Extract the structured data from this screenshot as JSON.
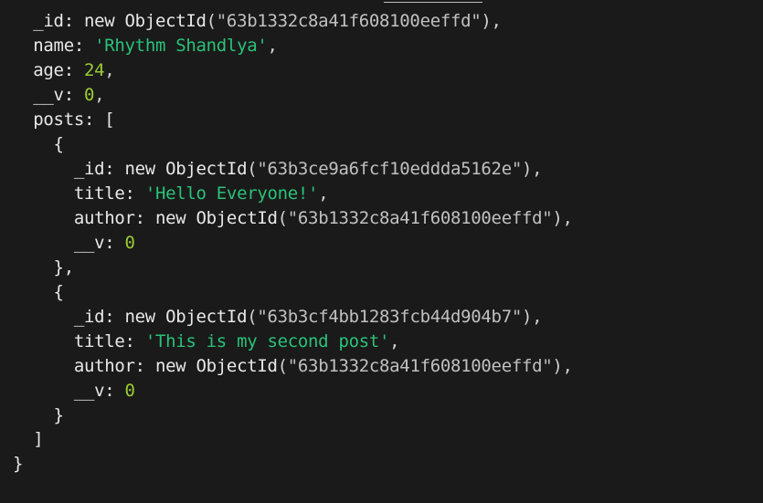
{
  "code": {
    "line1_key": "  _id: new ",
    "line1_fn": "ObjectId",
    "line1_arg": "\"63b1332c8a41f608100eeffd\"",
    "line1_end": "),",
    "line2_key": "  name: ",
    "line2_str": "'Rhythm Shandlya'",
    "line2_end": ",",
    "line3_key": "  age: ",
    "line3_num": "24",
    "line3_end": ",",
    "line4_key": "  __v: ",
    "line4_num": "0",
    "line4_end": ",",
    "line5": "  posts: [",
    "line6": "    {",
    "line7_key": "      _id: new ",
    "line7_fn": "ObjectId",
    "line7_arg": "\"63b3ce9a6fcf10eddda5162e\"",
    "line7_end": "),",
    "line8_key": "      title: ",
    "line8_str": "'Hello Everyone!'",
    "line8_end": ",",
    "line9_key": "      author: new ",
    "line9_fn": "ObjectId",
    "line9_arg": "\"63b1332c8a41f608100eeffd\"",
    "line9_end": "),",
    "line10_key": "      __v: ",
    "line10_num": "0",
    "line11": "    },",
    "line12": "    {",
    "line13_key": "      _id: new ",
    "line13_fn": "ObjectId",
    "line13_arg": "\"63b3cf4bb1283fcb44d904b7\"",
    "line13_end": "),",
    "line14_key": "      title: ",
    "line14_str": "'This is my second post'",
    "line14_end": ",",
    "line15_key": "      author: new ",
    "line15_fn": "ObjectId",
    "line15_arg": "\"63b1332c8a41f608100eeffd\"",
    "line15_end": "),",
    "line16_key": "      __v: ",
    "line16_num": "0",
    "line17": "    }",
    "line18": "  ]",
    "line19": "}"
  }
}
